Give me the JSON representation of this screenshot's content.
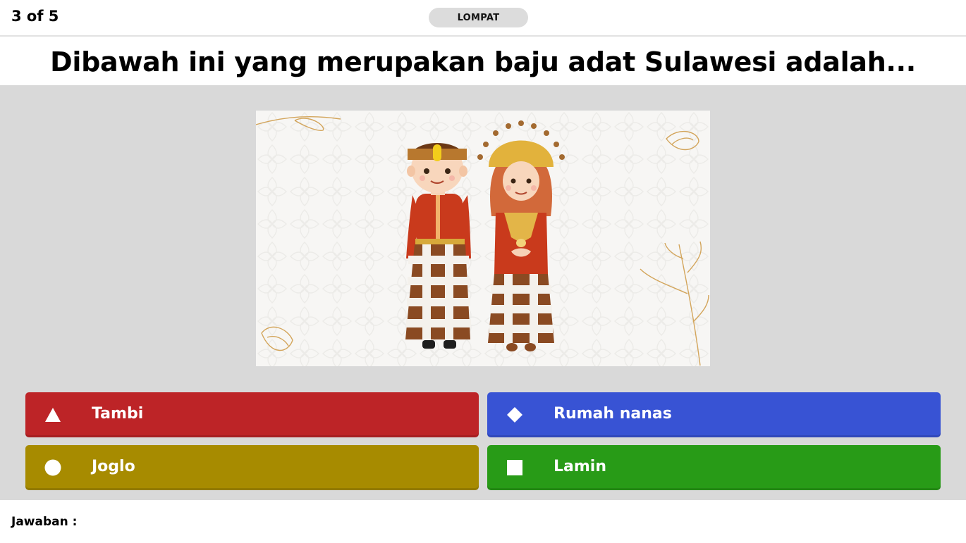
{
  "header": {
    "progress": "3 of 5",
    "skip_label": "LOMPAT"
  },
  "question": {
    "text": "Dibawah ini yang merupakan baju adat Sulawesi adalah..."
  },
  "illustration": {
    "subject": "Sulawesi traditional clothing couple"
  },
  "answers": [
    {
      "shape": "triangle-icon",
      "label": "Tambi",
      "color": "#bd2427"
    },
    {
      "shape": "diamond-icon",
      "label": "Rumah nanas",
      "color": "#3853d4"
    },
    {
      "shape": "circle-icon",
      "label": "Joglo",
      "color": "#a78b00"
    },
    {
      "shape": "square-icon",
      "label": "Lamin",
      "color": "#289b17"
    }
  ],
  "footer": {
    "answer_label": "Jawaban :"
  }
}
